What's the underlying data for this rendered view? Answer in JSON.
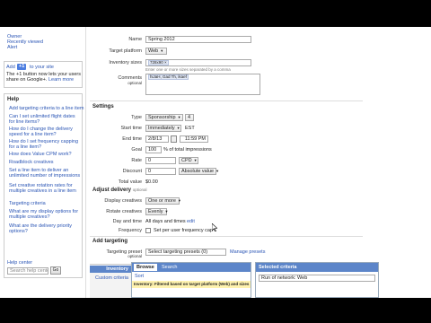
{
  "sidebar": {
    "top_links": [
      "Owner",
      "Recently viewed",
      "Alert"
    ],
    "plus_one": {
      "add_label": "Add",
      "button_label": "+1",
      "suffix": "to your site",
      "text": "The +1 button now lets your users share on Google+.",
      "learn_more": "Learn more"
    },
    "help_title": "Help",
    "help_items": [
      "Add targeting criteria to a line item",
      "Can I set unlimited flight dates for line items?",
      "How do I change the delivery speed for a line item?",
      "How do I set frequency capping for a line item?",
      "How does Value CPM work?",
      "Roadblock creatives",
      "Set a line item to deliver an unlimited number of impressions",
      "Set creative rotation rates for multiple creatives in a line item",
      "Targeting criteria",
      "What are my display options for multiple creatives?",
      "What are the delivery priority options?"
    ],
    "help_center_label": "Help center",
    "search_placeholder": "Search help center",
    "go_button": "Go"
  },
  "form": {
    "name_label": "Name",
    "name_value": "Spring 2012",
    "target_platform_label": "Target platform",
    "target_platform_value": "Web",
    "inventory_sizes_label": "Inventory sizes",
    "inventory_size_tag": "728x90",
    "inventory_sizes_hint": "Enter one or more sizes separated by a comma",
    "comments_label": "Comments",
    "comments_sub": "optional",
    "comments_value": "hiJaH, Gad Th, ikaef"
  },
  "settings": {
    "title": "Settings",
    "type_label": "Type",
    "type_value": "Sponsorship",
    "type_number": "4",
    "start_time_label": "Start time",
    "start_time_value": "Immediately",
    "start_time_tz": "EST",
    "end_time_label": "End time",
    "end_date": "2/8/13",
    "end_time": "11:59 PM",
    "goal_label": "Goal",
    "goal_value": "100",
    "goal_suffix": "% of total impressions",
    "rate_label": "Rate",
    "rate_value": "0",
    "rate_unit": "CPD",
    "discount_label": "Discount",
    "discount_value": "0",
    "discount_unit": "Absolute value",
    "total_value_label": "Total value",
    "total_value": "$0.00"
  },
  "delivery": {
    "title": "Adjust delivery",
    "title_sub": "optional",
    "display_creatives_label": "Display creatives",
    "display_creatives_value": "One or more",
    "rotate_creatives_label": "Rotate creatives",
    "rotate_creatives_value": "Evenly",
    "day_time_label": "Day and time",
    "day_time_value": "All days and times",
    "day_time_edit": "edit",
    "frequency_label": "Frequency",
    "frequency_checkbox_label": "Set per user frequency cap"
  },
  "targeting": {
    "title": "Add targeting",
    "preset_label": "Targeting preset",
    "preset_sub": "optional",
    "preset_value": "Select targeting presets (0)",
    "manage_presets": "Manage presets",
    "left_tabs": [
      "Inventory",
      "Custom criteria"
    ],
    "browse_tab": "Browse",
    "search_tab": "Search",
    "sort_label": "Sort",
    "inventory_filter_text": "Inventory: Filtered based on target platform (Web) and sizes",
    "selected_criteria_title": "Selected criteria",
    "selected_item": "Run of network: Web"
  },
  "colors": {
    "link": "#2a55b5",
    "tab_blue": "#5c85c9",
    "plus_one_blue": "#4d7ee0"
  }
}
